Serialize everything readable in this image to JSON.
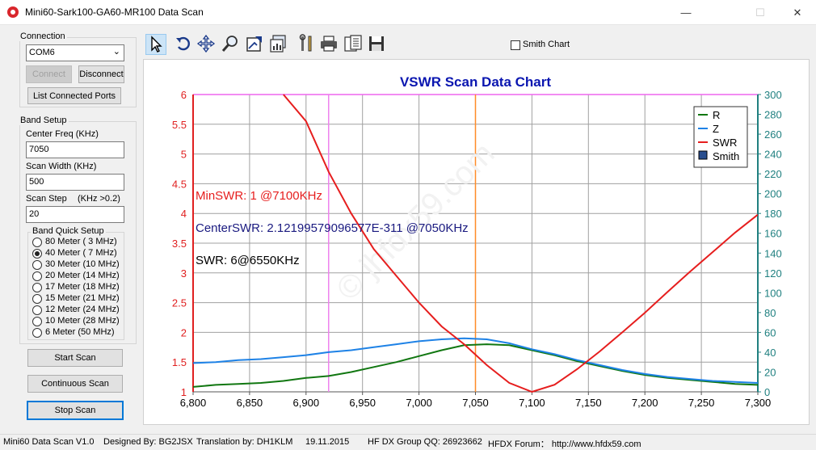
{
  "window": {
    "title": "Mini60-Sark100-GA60-MR100 Data Scan",
    "minimize": "—",
    "maximize": "☐",
    "close": "✕"
  },
  "connection": {
    "group_label": "Connection",
    "port_value": "COM6",
    "connect_label": "Connect",
    "disconnect_label": "Disconnect",
    "list_ports_label": "List Connected Ports"
  },
  "band_setup": {
    "group_label": "Band Setup",
    "center_freq_label": "Center Freq  (KHz)",
    "center_freq_value": "7050",
    "scan_width_label": "Scan Width   (KHz)",
    "scan_width_value": "500",
    "scan_step_label": "Scan Step",
    "scan_step_hint": "(KHz >0.2)",
    "scan_step_value": "20",
    "quick_label": "Band Quick Setup",
    "bands": [
      {
        "label": "80 Meter  ( 3 MHz)",
        "selected": false
      },
      {
        "label": "40 Meter  ( 7 MHz)",
        "selected": true
      },
      {
        "label": "30 Meter (10 MHz)",
        "selected": false
      },
      {
        "label": "20 Meter (14 MHz)",
        "selected": false
      },
      {
        "label": "17 Meter (18 MHz)",
        "selected": false
      },
      {
        "label": "15 Meter (21 MHz)",
        "selected": false
      },
      {
        "label": "12 Meter (24 MHz)",
        "selected": false
      },
      {
        "label": "10 Meter (28 MHz)",
        "selected": false
      },
      {
        "label": " 6 Meter  (50 MHz)",
        "selected": false
      }
    ]
  },
  "actions": {
    "start_scan": "Start Scan",
    "continuous_scan": "Continuous Scan",
    "stop_scan": "Stop Scan"
  },
  "toolbar": {
    "icons": [
      "pointer-icon",
      "rotate-icon",
      "pan-icon",
      "zoom-icon",
      "export-image-icon",
      "chart-settings-icon",
      "tools-icon",
      "print-icon",
      "copy-data-icon",
      "save-icon"
    ],
    "smith_chart_label": "Smith Chart",
    "smith_chart_checked": false
  },
  "annotations": {
    "min_swr": "MinSWR: 1 @7100KHz",
    "center_swr": "CenterSWR: 2.12199579096577E-311 @7050KHz",
    "swr": "SWR: 6@6550KHz",
    "watermark": "© jhfdx59.com"
  },
  "chart_data": {
    "type": "line",
    "title": "VSWR Scan Data Chart",
    "xlim": [
      6800,
      7300
    ],
    "x_ticks": [
      "6,800",
      "6,850",
      "6,900",
      "6,950",
      "7,000",
      "7,050",
      "7,100",
      "7,150",
      "7,200",
      "7,250",
      "7,300"
    ],
    "ylim_left": [
      1,
      6
    ],
    "y_ticks_left": [
      "1",
      "1.5",
      "2",
      "2.5",
      "3",
      "3.5",
      "4",
      "4.5",
      "5",
      "5.5",
      "6"
    ],
    "ylim_right": [
      0,
      300
    ],
    "y_ticks_right": [
      "0",
      "20",
      "40",
      "60",
      "80",
      "100",
      "120",
      "140",
      "160",
      "180",
      "200",
      "220",
      "240",
      "260",
      "280",
      "300"
    ],
    "grid": true,
    "legend_position": "top-right",
    "legend": [
      "R",
      "Z",
      "SWR",
      "Smith"
    ],
    "vertical_markers": [
      {
        "x": 6920,
        "color": "#ee82ee"
      },
      {
        "x": 7050,
        "color": "#ff8c28"
      }
    ],
    "series": [
      {
        "name": "R",
        "color": "#117711",
        "axis": "right",
        "x": [
          6800,
          6820,
          6840,
          6860,
          6880,
          6900,
          6920,
          6940,
          6960,
          6980,
          7000,
          7020,
          7040,
          7060,
          7080,
          7100,
          7120,
          7140,
          7160,
          7180,
          7200,
          7220,
          7240,
          7260,
          7280,
          7300
        ],
        "values": [
          5,
          7,
          8,
          9,
          11,
          14,
          16,
          20,
          25,
          30,
          36,
          42,
          47,
          48,
          47,
          42,
          37,
          31,
          26,
          21,
          17,
          14,
          12,
          10,
          8,
          7
        ]
      },
      {
        "name": "Z",
        "color": "#1e82e6",
        "axis": "right",
        "x": [
          6800,
          6820,
          6840,
          6860,
          6880,
          6900,
          6920,
          6940,
          6960,
          6980,
          7000,
          7020,
          7040,
          7060,
          7080,
          7100,
          7120,
          7140,
          7160,
          7180,
          7200,
          7220,
          7240,
          7260,
          7280,
          7300
        ],
        "values": [
          29,
          30,
          32,
          33,
          35,
          37,
          40,
          42,
          45,
          48,
          51,
          53,
          54,
          53,
          49,
          43,
          38,
          32,
          27,
          22,
          18,
          15,
          13,
          11,
          10,
          9
        ]
      },
      {
        "name": "SWR",
        "color": "#e61e1e",
        "axis": "left",
        "x": [
          6880,
          6900,
          6920,
          6940,
          6960,
          6980,
          7000,
          7020,
          7040,
          7060,
          7080,
          7100,
          7120,
          7140,
          7160,
          7180,
          7200,
          7220,
          7240,
          7260,
          7280,
          7300
        ],
        "values": [
          6.0,
          5.55,
          4.7,
          4.0,
          3.4,
          2.95,
          2.5,
          2.1,
          1.8,
          1.45,
          1.15,
          1.0,
          1.12,
          1.38,
          1.68,
          2.0,
          2.33,
          2.68,
          3.02,
          3.35,
          3.68,
          3.98
        ]
      }
    ]
  },
  "status": {
    "version": "Mini60 Data Scan V1.0",
    "designed_by": "Designed By: BG2JSX",
    "translation": "Translation by: DH1KLM",
    "date": "19.11.2015",
    "qq": "HF DX Group QQ: 26923662",
    "forum": "HFDX Forum：  http://www.hfdx59.com"
  }
}
